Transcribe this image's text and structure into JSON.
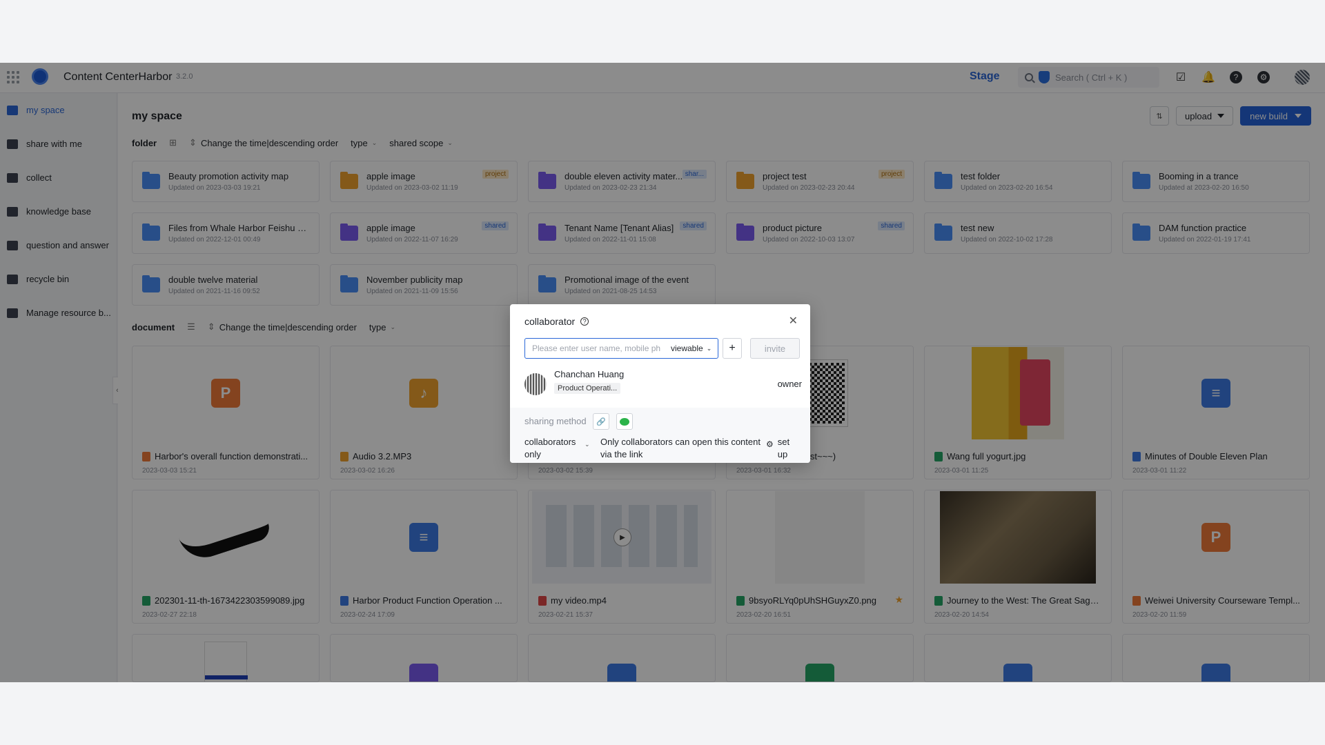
{
  "topbar": {
    "app_title": "Content CenterHarbor",
    "version": "3.2.0",
    "stage": "Stage",
    "search_placeholder": "Search ( Ctrl + K )"
  },
  "sidebar": {
    "items": [
      {
        "label": "my space"
      },
      {
        "label": "share with me"
      },
      {
        "label": "collect"
      },
      {
        "label": "knowledge base"
      },
      {
        "label": "question and answer"
      },
      {
        "label": "recycle bin"
      },
      {
        "label": "Manage resource b..."
      }
    ]
  },
  "main": {
    "title": "my space",
    "upload_label": "upload",
    "new_build_label": "new build",
    "folder_toolbar": {
      "label": "folder",
      "sort": "Change the time|descending order",
      "type": "type",
      "scope": "shared scope"
    },
    "doc_toolbar": {
      "label": "document",
      "sort": "Change the time|descending order",
      "type": "type"
    },
    "folders": [
      {
        "name": "Beauty promotion activity map",
        "date": "Updated on 2023-03-03 19:21",
        "tag": "",
        "kind": "normal"
      },
      {
        "name": "apple image",
        "date": "Updated on 2023-03-02 11:19",
        "tag": "project",
        "kind": "proj"
      },
      {
        "name": "double eleven activity mater...",
        "date": "Updated on 2023-02-23 21:34",
        "tag": "shar...",
        "kind": "share"
      },
      {
        "name": "project test",
        "date": "Updated on 2023-02-23 20:44",
        "tag": "project",
        "kind": "proj"
      },
      {
        "name": "test folder",
        "date": "Updated on 2023-02-20 16:54",
        "tag": "",
        "kind": "normal"
      },
      {
        "name": "Booming in a trance",
        "date": "Updated at 2023-02-20 16:50",
        "tag": "",
        "kind": "normal"
      },
      {
        "name": "Files from Whale Harbor Feishu Ro...",
        "date": "Updated on 2022-12-01 00:49",
        "tag": "",
        "kind": "normal"
      },
      {
        "name": "apple image",
        "date": "Updated on 2022-11-07 16:29",
        "tag": "shared",
        "kind": "share"
      },
      {
        "name": "Tenant Name [Tenant Alias]",
        "date": "Updated on 2022-11-01 15:08",
        "tag": "shared",
        "kind": "share"
      },
      {
        "name": "product picture",
        "date": "Updated on 2022-10-03 13:07",
        "tag": "shared",
        "kind": "share"
      },
      {
        "name": "test new",
        "date": "Updated on 2022-10-02 17:28",
        "tag": "",
        "kind": "normal"
      },
      {
        "name": "DAM function practice",
        "date": "Updated on 2022-01-19 17:41",
        "tag": "",
        "kind": "normal"
      },
      {
        "name": "double twelve material",
        "date": "Updated on 2021-11-16 09:52",
        "tag": "",
        "kind": "normal"
      },
      {
        "name": "November publicity map",
        "date": "Updated on 2021-11-09 15:56",
        "tag": "",
        "kind": "normal"
      },
      {
        "name": "Promotional image of the event",
        "date": "Updated on 2021-08-25 14:53",
        "tag": "",
        "kind": "normal"
      }
    ],
    "documents": [
      {
        "name": "Harbor's overall function demonstrati...",
        "date": "2023-03-03 15:21",
        "icon": "ppt",
        "letter": "P"
      },
      {
        "name": "Audio 3.2.MP3",
        "date": "2023-03-02 16:26",
        "icon": "audio",
        "letter": "♪"
      },
      {
        "name": "",
        "date": "2023-03-02 15:39",
        "icon": "hidden",
        "letter": ""
      },
      {
        "name": "sign-in code (test~~~)",
        "date": "2023-03-01 16:32",
        "icon": "qr",
        "letter": ""
      },
      {
        "name": "Wang full yogurt.jpg",
        "date": "2023-03-01 11:25",
        "icon": "yogurt",
        "letter": ""
      },
      {
        "name": "Minutes of Double Eleven Plan",
        "date": "2023-03-01 11:22",
        "icon": "doc",
        "letter": "≡"
      },
      {
        "name": "202301-11-th-1673422303599089.jpg",
        "date": "2023-02-27 22:18",
        "icon": "swoosh",
        "letter": ""
      },
      {
        "name": "Harbor Product Function Operation ...",
        "date": "2023-02-24 17:09",
        "icon": "doc",
        "letter": "≡"
      },
      {
        "name": "my video.mp4",
        "date": "2023-02-21 15:37",
        "icon": "video",
        "letter": ""
      },
      {
        "name": "9bsyoRLYq0pUhSHGuyxZ0.png",
        "date": "2023-02-20 16:51",
        "icon": "blank",
        "letter": "",
        "starred": true
      },
      {
        "name": "Journey to the West: The Great Sage ...",
        "date": "2023-02-20 14:54",
        "icon": "movie",
        "letter": ""
      },
      {
        "name": "Weiwei University Courseware Templ...",
        "date": "2023-02-20 11:59",
        "icon": "ppt",
        "letter": "P"
      }
    ]
  },
  "modal": {
    "title": "collaborator",
    "input_placeholder": "Please enter user name, mobile ph",
    "permission": "viewable",
    "invite_label": "invite",
    "member": {
      "name": "Chanchan Huang",
      "dept": "Product Operati...",
      "role": "owner"
    },
    "sharing_method_label": "sharing method",
    "scope": "collaborators only",
    "scope_desc": "Only collaborators can open this content via the link",
    "setup": "set up"
  },
  "colors": {
    "accent": "#2563d9",
    "folder": "#4a8ef7",
    "project": "#f0a32f",
    "shared": "#7b5cf0"
  }
}
